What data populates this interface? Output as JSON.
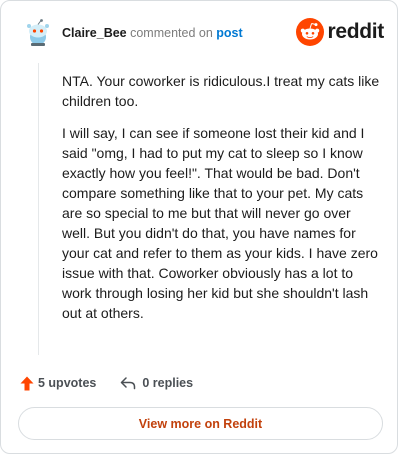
{
  "header": {
    "username": "Claire_Bee",
    "action_text": "commented on",
    "post_link": "post",
    "brand": "reddit"
  },
  "comment": {
    "paragraphs": [
      "NTA. Your coworker is ridiculous.I treat my cats like children too.",
      "I will say, I can see if someone lost their kid and I said \"omg, I had to put my cat to sleep so I know exactly how you feel!\". That would be bad. Don't compare something like that to your pet. My cats are so special to me but that will never go over well. But you didn't do that, you have names for your cat and refer to them as your kids. I have zero issue with that. Coworker obviously has a lot to work through losing her kid but she shouldn't lash out at others."
    ]
  },
  "actions": {
    "upvotes": "5 upvotes",
    "replies": "0 replies"
  },
  "footer": {
    "view_more": "View more on Reddit"
  },
  "colors": {
    "brand": "#ff4500",
    "link": "#0079d3",
    "upvote": "#ff4500",
    "view_more_text": "#c2410c"
  },
  "icons": {
    "avatar": "snoo-avatar-icon",
    "brand": "reddit-logo-icon",
    "upvote": "upvote-arrow-icon",
    "reply": "reply-arrow-icon"
  }
}
